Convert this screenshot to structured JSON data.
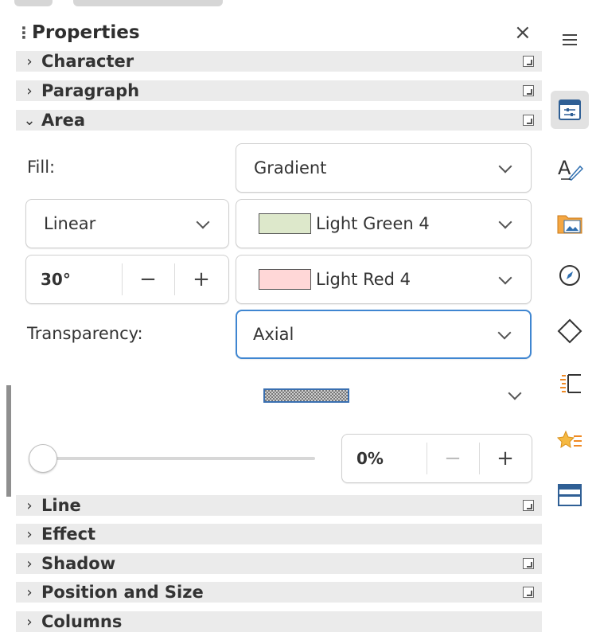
{
  "panel": {
    "title": "Properties",
    "close_glyph": "×"
  },
  "sections": {
    "character": "Character",
    "paragraph": "Paragraph",
    "area": "Area",
    "line": "Line",
    "effect": "Effect",
    "shadow": "Shadow",
    "position_size": "Position and Size",
    "columns": "Columns"
  },
  "area": {
    "fill_label": "Fill:",
    "fill_value": "Gradient",
    "gradient_type": "Linear",
    "angle": "30°",
    "color1": {
      "name": "Light Green 4",
      "hex": "#dde8cb"
    },
    "color2": {
      "name": "Light Red 4",
      "hex": "#ffd7d7"
    },
    "transparency_label": "Transparency:",
    "transparency_value": "Axial",
    "transparency_percent": "0%",
    "slider_value": 0
  },
  "stepper": {
    "minus": "−",
    "plus": "+"
  },
  "sidebar_tabs": [
    {
      "name": "sidebar-menu-icon"
    },
    {
      "name": "properties-tab-icon",
      "selected": true
    },
    {
      "name": "styles-tab-icon"
    },
    {
      "name": "gallery-tab-icon"
    },
    {
      "name": "navigator-tab-icon"
    },
    {
      "name": "shapes-tab-icon"
    },
    {
      "name": "page-tab-icon"
    },
    {
      "name": "style-inspector-tab-icon"
    },
    {
      "name": "manage-changes-tab-icon"
    }
  ],
  "colors": {
    "section_bg": "#ebebeb",
    "focus": "#3f86d1",
    "accent_orange": "#f08a24"
  }
}
